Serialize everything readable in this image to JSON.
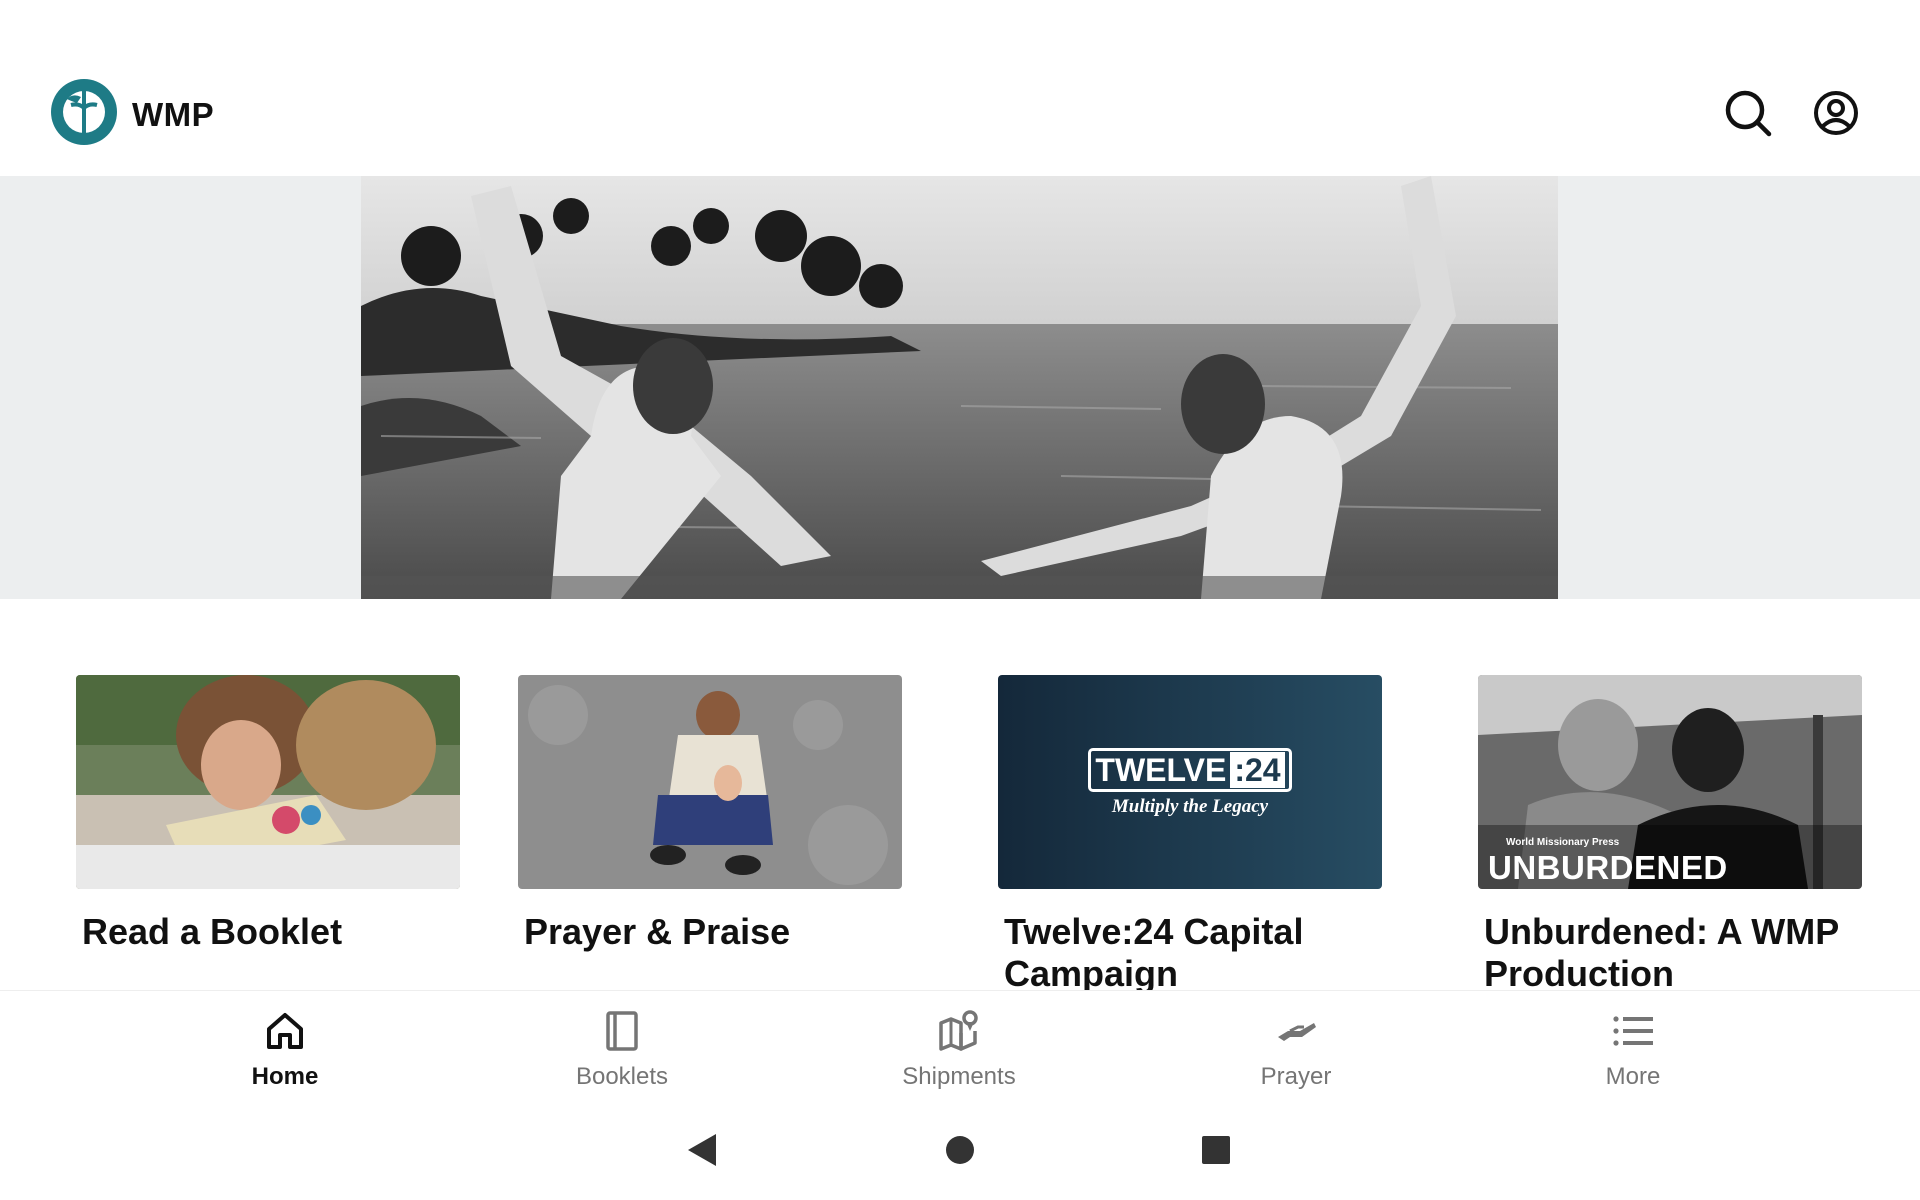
{
  "app": {
    "title": "WMP",
    "brand_color": "#1e7b86"
  },
  "header": {
    "search_icon": "search-icon",
    "account_icon": "account-circle-icon"
  },
  "hero": {
    "image": "baptism-photo-two-men-in-water"
  },
  "cards": [
    {
      "title": "Read a Booklet",
      "image": "children-reading-booklet-photo"
    },
    {
      "title": "Prayer & Praise",
      "image": "child-praying-on-pavement-photo"
    },
    {
      "title": "Twelve:24 Capital Campaign",
      "image": "twelve24-logo",
      "logo_main": "TWELVE",
      "logo_num": ":24",
      "logo_sub": "Multiply the Legacy"
    },
    {
      "title": "Unburdened: A WMP Production",
      "image": "unburdened-video-thumbnail",
      "overlay_small": "World Missionary Press",
      "overlay_big": "UNBURDENED"
    }
  ],
  "bottom_nav": {
    "items": [
      {
        "label": "Home",
        "icon": "home-icon",
        "active": true
      },
      {
        "label": "Booklets",
        "icon": "book-icon",
        "active": false
      },
      {
        "label": "Shipments",
        "icon": "map-pin-icon",
        "active": false
      },
      {
        "label": "Prayer",
        "icon": "hand-icon",
        "active": false
      },
      {
        "label": "More",
        "icon": "list-icon",
        "active": false
      }
    ]
  },
  "system_nav": {
    "back": "back-triangle-icon",
    "home": "home-circle-icon",
    "recents": "recents-square-icon"
  }
}
